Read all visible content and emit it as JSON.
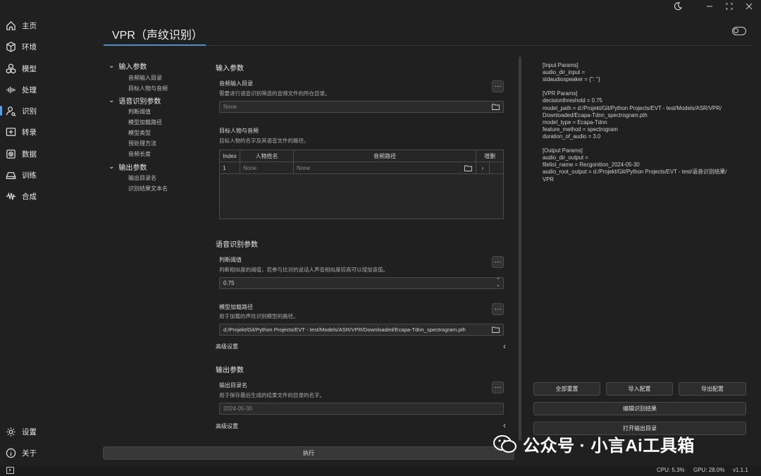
{
  "app": {
    "title": "VPR（声纹识别）"
  },
  "sidebar": {
    "items": [
      {
        "label": "主页",
        "icon": "home-icon"
      },
      {
        "label": "环境",
        "icon": "cube-icon"
      },
      {
        "label": "模型",
        "icon": "cubes-icon"
      },
      {
        "label": "处理",
        "icon": "waveform-icon"
      },
      {
        "label": "识别",
        "icon": "user-recognize-icon"
      },
      {
        "label": "转录",
        "icon": "transcribe-icon"
      },
      {
        "label": "数据",
        "icon": "database-icon"
      },
      {
        "label": "训练",
        "icon": "drive-icon"
      },
      {
        "label": "合成",
        "icon": "synth-wave-icon"
      }
    ],
    "bottom": [
      {
        "label": "设置",
        "icon": "gear-icon"
      },
      {
        "label": "关于",
        "icon": "info-icon"
      }
    ]
  },
  "tree": {
    "groups": [
      {
        "label": "输入参数",
        "items": [
          "音频输入目录",
          "目标人物与音频"
        ]
      },
      {
        "label": "语音识别参数",
        "items": [
          "判断阈值",
          "模型加载路径",
          "模型类型",
          "预处理方法",
          "音频长度"
        ]
      },
      {
        "label": "输出参数",
        "items": [
          "输出目录名",
          "识别结果文本名"
        ]
      }
    ]
  },
  "input_section": {
    "title": "输入参数",
    "audio_dir": {
      "label": "音频输入目录",
      "desc": "需要进行语音识别筛选的音频文件的所在目录。",
      "placeholder": "None"
    },
    "speaker": {
      "label": "目标人物与音频",
      "desc": "目标人物的名字及其语音文件的路径。",
      "columns": [
        "Index",
        "人物姓名",
        "音频路径",
        "增删"
      ],
      "rows": [
        {
          "index": "1",
          "name": "None",
          "path": "None"
        }
      ]
    }
  },
  "vpr_section": {
    "title": "语音识别参数",
    "threshold": {
      "label": "判断阈值",
      "desc": "判断相似度的阈值，若参与比对的说话人声音相似度较高可以增加该值。",
      "value": "0.75"
    },
    "model_path": {
      "label": "模型加载路径",
      "desc": "用于加载的声纹识别模型的路径。",
      "value": "d:/Projekt/Git/Python Projects/EVT - test/Models/ASR/VPR/Downloaded/Ecapa-Tdnn_spectrogram.pth"
    },
    "advanced": "高级设置"
  },
  "output_section": {
    "title": "输出参数",
    "dir_name": {
      "label": "输出目录名",
      "desc": "用于保存最后生成的结果文件的目录的名字。",
      "value": "2024-05-30"
    },
    "advanced": "高级设置"
  },
  "run_button": "执行",
  "config_text": "[Input Params]\naudio_dir_input = \nstdaudiospeaker = {'': ''}\n\n[VPR Params]\ndecisionthreshold = 0.75\nmodel_path = d:/Projekt/Git/Python Projects/EVT - test/Models/ASR/VPR/\nDownloaded/Ecapa-Tdnn_spectrogram.pth\nmodel_type = Ecapa-Tdnn\nfeature_method = spectrogram\nduration_of_audio = 3.0\n\n[Output Params]\naudio_dir_output = \nfilelist_name = Recgonition_2024-05-30\naudio_root_output = d:/Projekt/Git/Python Projects/EVT - test/语音识别结果/\nVPR",
  "config_buttons": {
    "reset_all": "全部重置",
    "import": "导入配置",
    "export": "导出配置",
    "edit_result": "编辑识别结果",
    "open_output": "打开输出目录"
  },
  "status": {
    "cpu": "CPU: 5.3%",
    "gpu": "GPU: 28.0%",
    "version": "v1.1.1"
  },
  "watermark": "公众号 · 小言Ai工具箱",
  "colors": {
    "accent": "#4a8fd6",
    "background": "#202020",
    "panel": "#282828"
  }
}
